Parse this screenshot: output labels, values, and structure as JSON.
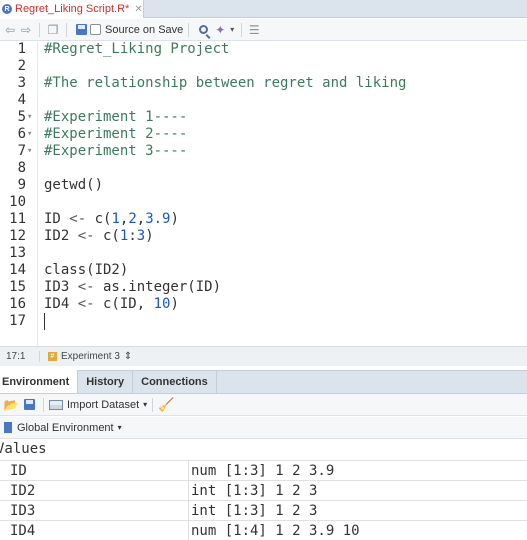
{
  "editor_tab": {
    "title": "Regret_Liking Script.R*",
    "close": "✕"
  },
  "toolbar": {
    "source_on_save": "Source on Save"
  },
  "code": [
    {
      "n": "1",
      "fold": "",
      "segments": [
        {
          "cls": "cmt",
          "t": "#Regret_Liking Project"
        }
      ]
    },
    {
      "n": "2",
      "fold": "",
      "segments": []
    },
    {
      "n": "3",
      "fold": "",
      "segments": [
        {
          "cls": "cmt",
          "t": "#The relationship between regret and liking"
        }
      ]
    },
    {
      "n": "4",
      "fold": "",
      "segments": []
    },
    {
      "n": "5",
      "fold": "▾",
      "segments": [
        {
          "cls": "cmt",
          "t": "#Experiment 1----"
        }
      ]
    },
    {
      "n": "6",
      "fold": "▾",
      "segments": [
        {
          "cls": "cmt",
          "t": "#Experiment 2----"
        }
      ]
    },
    {
      "n": "7",
      "fold": "▾",
      "segments": [
        {
          "cls": "cmt",
          "t": "#Experiment 3----"
        }
      ]
    },
    {
      "n": "8",
      "fold": "",
      "segments": []
    },
    {
      "n": "9",
      "fold": "",
      "segments": [
        {
          "cls": "id",
          "t": "getwd()"
        }
      ]
    },
    {
      "n": "10",
      "fold": "",
      "segments": []
    },
    {
      "n": "11",
      "fold": "",
      "segments": [
        {
          "cls": "id",
          "t": "ID "
        },
        {
          "cls": "op",
          "t": "<-"
        },
        {
          "cls": "id",
          "t": " c("
        },
        {
          "cls": "num",
          "t": "1"
        },
        {
          "cls": "id",
          "t": ","
        },
        {
          "cls": "num",
          "t": "2"
        },
        {
          "cls": "id",
          "t": ","
        },
        {
          "cls": "num",
          "t": "3.9"
        },
        {
          "cls": "id",
          "t": ")"
        }
      ]
    },
    {
      "n": "12",
      "fold": "",
      "segments": [
        {
          "cls": "id",
          "t": "ID2 "
        },
        {
          "cls": "op",
          "t": "<-"
        },
        {
          "cls": "id",
          "t": " c("
        },
        {
          "cls": "num",
          "t": "1"
        },
        {
          "cls": "id",
          "t": ":"
        },
        {
          "cls": "num",
          "t": "3"
        },
        {
          "cls": "id",
          "t": ")"
        }
      ]
    },
    {
      "n": "13",
      "fold": "",
      "segments": []
    },
    {
      "n": "14",
      "fold": "",
      "segments": [
        {
          "cls": "id",
          "t": "class(ID2)"
        }
      ]
    },
    {
      "n": "15",
      "fold": "",
      "segments": [
        {
          "cls": "id",
          "t": "ID3 "
        },
        {
          "cls": "op",
          "t": "<-"
        },
        {
          "cls": "id",
          "t": " as.integer(ID)"
        }
      ]
    },
    {
      "n": "16",
      "fold": "",
      "segments": [
        {
          "cls": "id",
          "t": "ID4 "
        },
        {
          "cls": "op",
          "t": "<-"
        },
        {
          "cls": "id",
          "t": " c(ID, "
        },
        {
          "cls": "num",
          "t": "10"
        },
        {
          "cls": "id",
          "t": ")"
        }
      ]
    },
    {
      "n": "17",
      "fold": "",
      "segments": []
    }
  ],
  "status": {
    "position": "17:1",
    "chunk": "Experiment 3",
    "chunk_arrow": "⇕"
  },
  "env_tabs": {
    "environment": "Environment",
    "history": "History",
    "connections": "Connections"
  },
  "env_toolbar": {
    "import_dataset": "Import Dataset",
    "dropdown": "▾",
    "global_env": "Global Environment"
  },
  "values": {
    "header": "Values",
    "rows": [
      {
        "name": "ID",
        "value": "num [1:3] 1 2 3.9"
      },
      {
        "name": "ID2",
        "value": "int [1:3] 1 2 3"
      },
      {
        "name": "ID3",
        "value": "int [1:3] 1 2 3"
      },
      {
        "name": "ID4",
        "value": "num [1:4] 1 2 3.9 10"
      }
    ]
  }
}
